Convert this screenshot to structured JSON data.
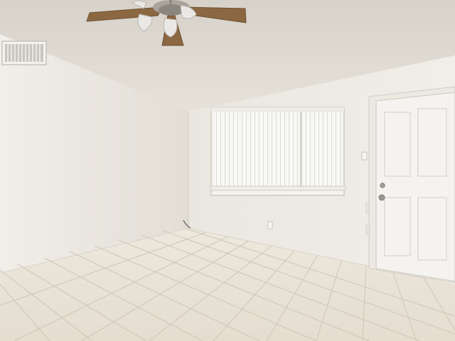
{
  "scene": {
    "kind": "empty-room-interior",
    "colors": {
      "ceiling": "#dcd8d0",
      "left_wall": "#e9e6df",
      "back_wall": "#efece6",
      "floor_tile": "#e9e4d9",
      "grout": "#cfc8ba",
      "door": "#f3f2ee",
      "blinds": "#f7f7f4",
      "fan_blade": "#8d6a45"
    },
    "objects": [
      {
        "name": "ceiling-fan-icon"
      },
      {
        "name": "air-vent-icon"
      },
      {
        "name": "window-blinds"
      },
      {
        "name": "entry-door"
      },
      {
        "name": "door-knob-icon"
      },
      {
        "name": "wall-outlet-icon"
      },
      {
        "name": "light-switch-icon"
      }
    ]
  }
}
